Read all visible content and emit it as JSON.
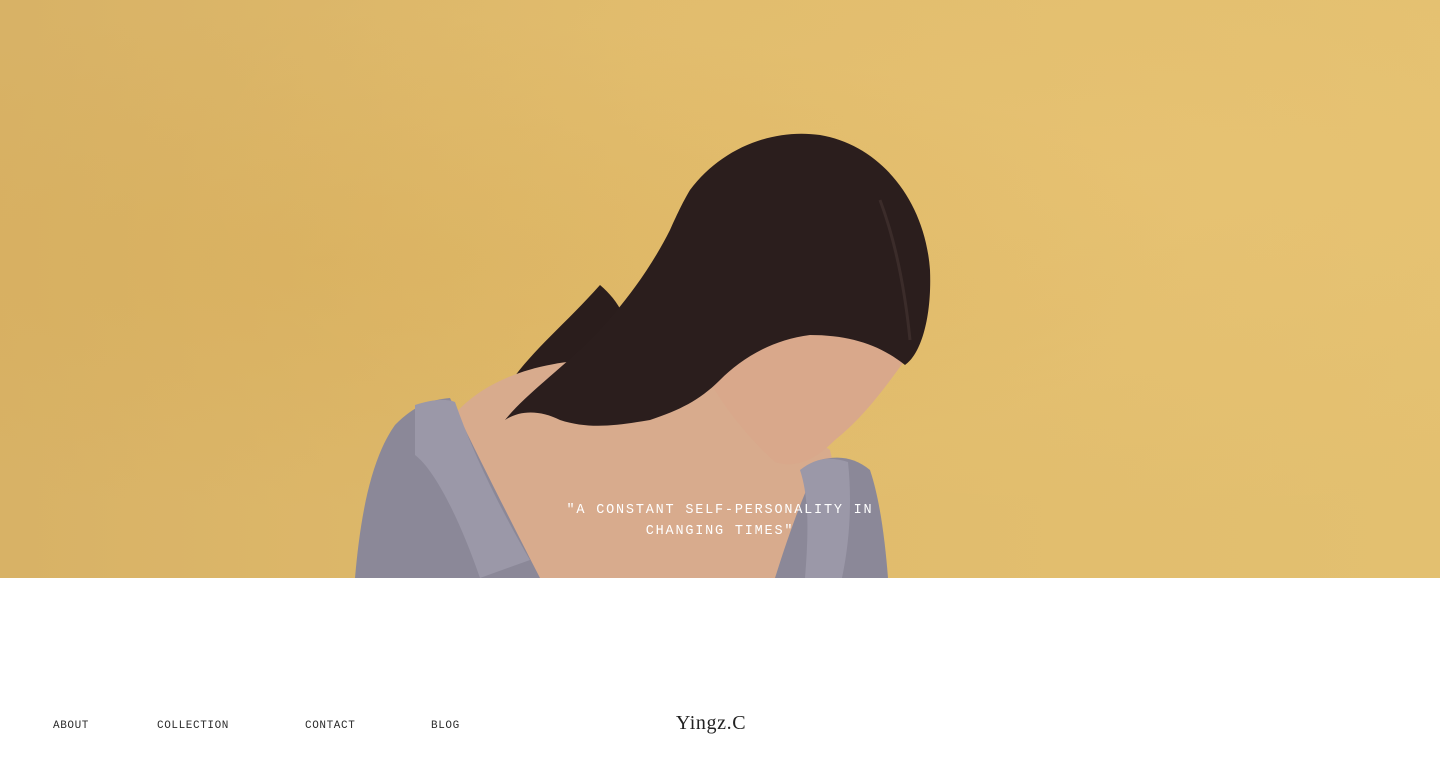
{
  "hero": {
    "quote": "\"A CONSTANT SELF-PERSONALITY IN CHANGING TIMES\"",
    "background_color": "#e0bb6c"
  },
  "nav": {
    "items": [
      {
        "label": "ABOUT"
      },
      {
        "label": "COLLECTION"
      },
      {
        "label": "CONTACT"
      },
      {
        "label": "BLOG"
      }
    ],
    "brand": "Yingz.C"
  }
}
